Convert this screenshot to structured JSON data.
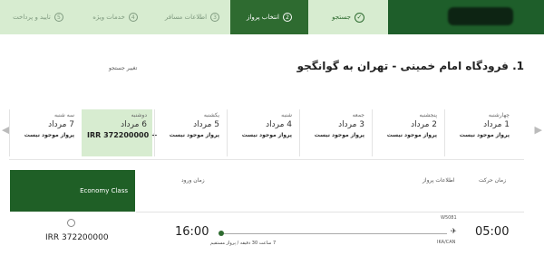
{
  "steps": [
    {
      "label": "جستجو",
      "state": "done"
    },
    {
      "num": "2",
      "label": "انتخاب پرواز",
      "state": "active"
    },
    {
      "num": "3",
      "label": "اطلاعات مسافر",
      "state": "pending"
    },
    {
      "num": "4",
      "label": "خدمات ویژه",
      "state": "pending"
    },
    {
      "num": "5",
      "label": "تایید و پرداخت",
      "state": "pending"
    }
  ],
  "route": {
    "title": "1. فرودگاه امام خمینی - تهران به گوانگجو",
    "change_search": "تغییر جستجو"
  },
  "dates": [
    {
      "weekday": "چهارشنبه",
      "date": "1 مرداد",
      "status": "پرواز موجود نیست",
      "selected": false
    },
    {
      "weekday": "پنجشنبه",
      "date": "2 مرداد",
      "status": "پرواز موجود نیست",
      "selected": false
    },
    {
      "weekday": "جمعه",
      "date": "3 مرداد",
      "status": "پرواز موجود نیست",
      "selected": false
    },
    {
      "weekday": "شنبه",
      "date": "4 مرداد",
      "status": "پرواز موجود نیست",
      "selected": false
    },
    {
      "weekday": "یکشنبه",
      "date": "5 مرداد",
      "status": "پرواز موجود نیست",
      "selected": false
    },
    {
      "weekday": "دوشنبه",
      "date": "6 مرداد",
      "status": "IRR 372200000 +",
      "selected": true
    },
    {
      "weekday": "سه شنبه",
      "date": "7 مرداد",
      "status": "پرواز موجود نیست",
      "selected": false
    }
  ],
  "table": {
    "class_label": "Economy Class",
    "col_departure": "زمان حرکت",
    "col_flight_info": "اطلاعات پرواز",
    "col_arrival": "زمان ورود"
  },
  "flight": {
    "number": "W5081",
    "departure_time": "05:00",
    "arrival_time": "16:00",
    "route_code": "IKA/CAN",
    "duration": "7 ساعت 30 دقیقه / پرواز مستقیم",
    "price": "IRR 372200000"
  },
  "icons": {
    "check": "check-icon",
    "arrow_left": "chevron-left-icon",
    "arrow_right": "chevron-right-icon",
    "plane": "airplane-icon"
  },
  "colors": {
    "brand_green": "#1f5f26",
    "light_green": "#d7ecd0"
  }
}
